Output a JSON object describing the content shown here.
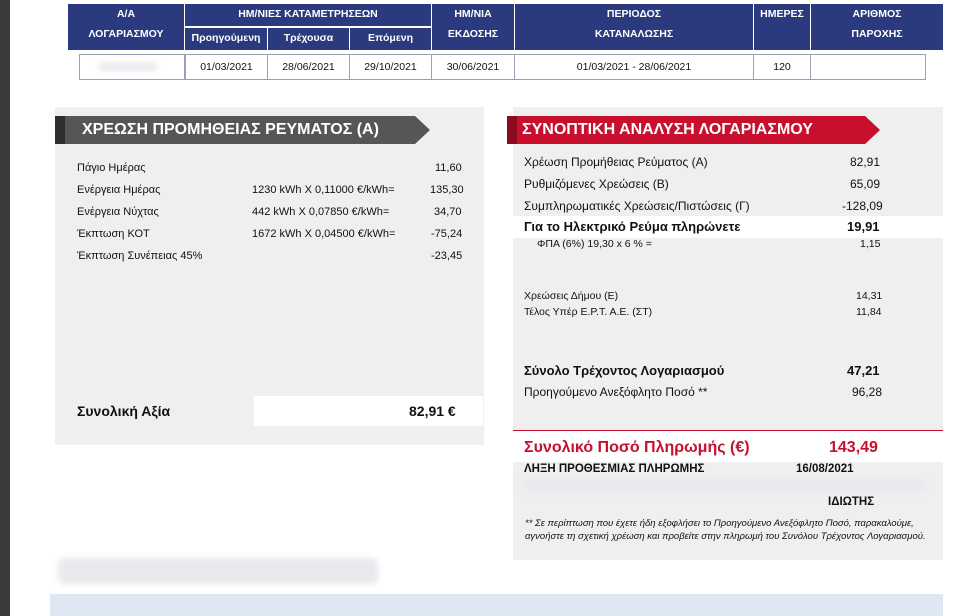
{
  "header": {
    "col_account": [
      "Α/Α",
      "ΛΟΓΑΡΙΑΣΜΟΥ"
    ],
    "col_dates_title": "ΗΜ/ΝΙΕΣ ΚΑΤΑΜΕΤΡΗΣΕΩΝ",
    "col_prev": "Προηγούμενη",
    "col_curr": "Τρέχουσα",
    "col_next": "Επόμενη",
    "col_issue": [
      "ΗΜ/ΝΙΑ",
      "ΕΚΔΟΣΗΣ"
    ],
    "col_period": [
      "ΠΕΡΙΟΔΟΣ",
      "ΚΑΤΑΝΑΛΩΣΗΣ"
    ],
    "col_days": "ΗΜΕΡΕΣ",
    "col_supply": [
      "ΑΡΙΘΜΟΣ",
      "ΠΑΡΟΧΗΣ"
    ],
    "values": {
      "prev": "01/03/2021",
      "curr": "28/06/2021",
      "next": "29/10/2021",
      "issue": "30/06/2021",
      "period": "01/03/2021 - 28/06/2021",
      "days": "120"
    }
  },
  "left": {
    "title": "ΧΡΕΩΣΗ ΠΡΟΜΗΘΕΙΑΣ ΡΕΥΜΑΤΟΣ (Α)",
    "rows": [
      {
        "label": "Πάγιο Ημέρας",
        "calc": "",
        "value": "11,60"
      },
      {
        "label": "Ενέργεια Ημέρας",
        "calc": "1230 kWh X 0,11000 €/kWh=",
        "value": "135,30"
      },
      {
        "label": "Ενέργεια Νύχτας",
        "calc": "442 kWh X 0,07850 €/kWh=",
        "value": "34,70"
      },
      {
        "label": "Έκπτωση ΚΟΤ",
        "calc": "1672 kWh X 0,04500 €/kWh=",
        "value": "-75,24"
      },
      {
        "label": "Έκπτωση Συνέπειας 45%",
        "calc": "",
        "value": "-23,45"
      }
    ],
    "total_label": "Συνολική Αξία",
    "total_value": "82,91 €"
  },
  "right": {
    "title": "ΣΥΝΟΠΤΙΚΗ ΑΝΑΛΥΣΗ ΛΟΓΑΡΙΑΣΜΟΥ",
    "rows": [
      {
        "label": "Χρέωση Προμήθειας Ρεύματος (Α)",
        "value": "82,91"
      },
      {
        "label": "Ρυθμιζόμενες Χρεώσεις (Β)",
        "value": "65,09"
      },
      {
        "label": "Συμπληρωματικές Χρεώσεις/Πιστώσεις (Γ)",
        "value": "-128,09"
      }
    ],
    "electric_label": "Για το Ηλεκτρικό Ρεύμα πληρώνετε",
    "electric_value": "19,91",
    "vat_label": "ΦΠΑ (6%) 19,30 x 6 % =",
    "vat_value": "1,15",
    "municipal_label": "Χρεώσεις Δήμου (Ε)",
    "municipal_value": "14,31",
    "ert_label": "Τέλος Υπέρ Ε.Ρ.Τ. Α.Ε. (ΣΤ)",
    "ert_value": "11,84",
    "current_total_label": "Σύνολο Τρέχοντος Λογαριασμού",
    "current_total_value": "47,21",
    "prev_unpaid_label": "Προηγούμενο Ανεξόφλητο Ποσό **",
    "prev_unpaid_value": "96,28",
    "payment_label": "Συνολικό Ποσό Πληρωμής (€)",
    "payment_value": "143,49",
    "deadline_label": "ΛΗΞΗ ΠΡΟΘΕΣΜΙΑΣ ΠΛΗΡΩΜΗΣ",
    "deadline_value": "16/08/2021",
    "owner_label": "ΙΔΙΩΤΗΣ",
    "footnote": "** Σε περίπτωση που έχετε ήδη εξοφλήσει το Προηγούμενο Ανεξόφλητο Ποσό, παρακαλούμε, αγνοήστε τη σχετική χρέωση και προβείτε στην πληρωμή του Συνόλου Τρέχοντος Λογαριασμού."
  },
  "colors": {
    "header_bg": "#2b3a7e",
    "accent_red": "#c8102e",
    "left_banner": "#555658"
  }
}
